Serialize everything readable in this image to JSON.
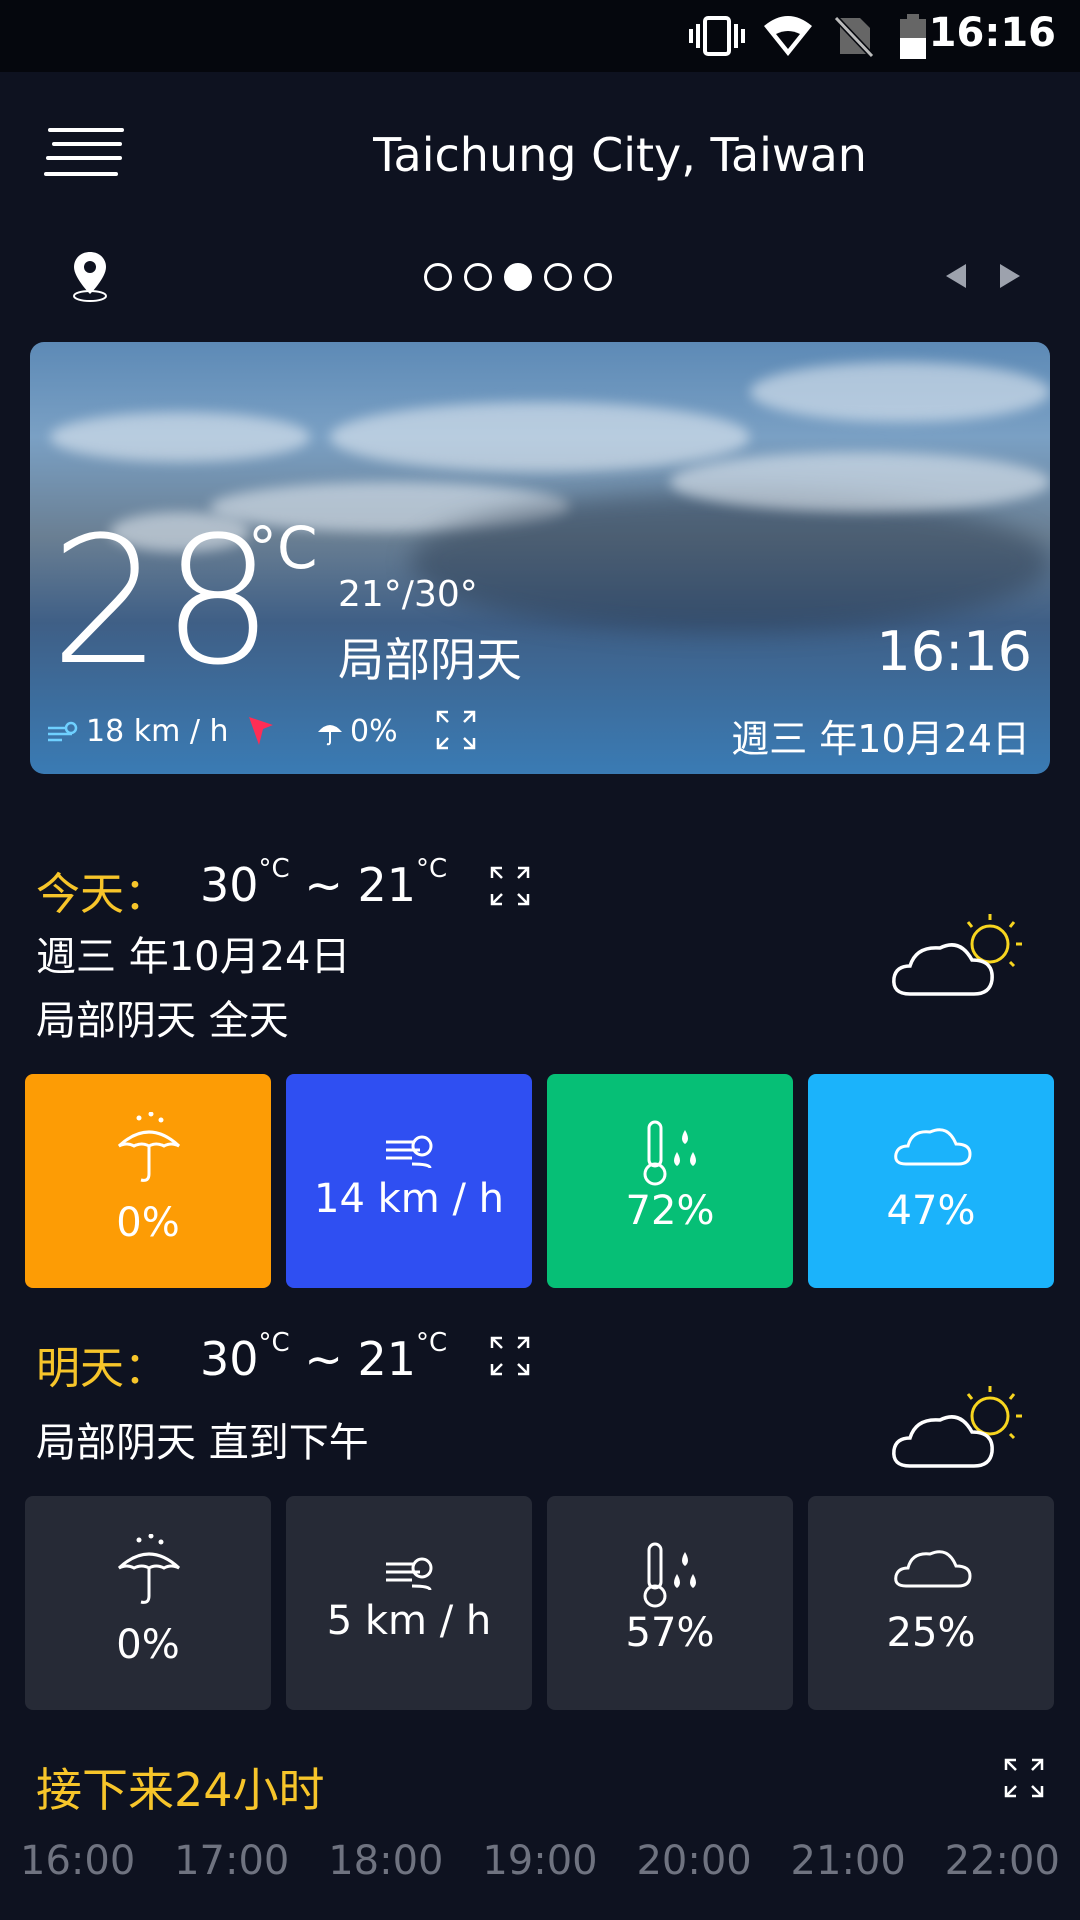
{
  "status_bar": {
    "time": "16:16",
    "icons": [
      "vibrate-icon",
      "wifi-icon",
      "no-sim-icon",
      "battery-icon"
    ]
  },
  "header": {
    "title": "Taichung City, Taiwan"
  },
  "pager": {
    "count": 5,
    "active_index": 2
  },
  "hero": {
    "temp": "28",
    "unit": "°C",
    "range": "21°/30°",
    "condition": "局部阴天",
    "time": "16:16",
    "wind": "18 km / h",
    "rain": "0%",
    "date": "週三 年10月24日"
  },
  "today": {
    "label": "今天：",
    "high": "30",
    "low": "21",
    "unit": "°C",
    "tilde": "~",
    "date": "週三 年10月24日",
    "summary": "局部阴天 全天",
    "cards": [
      {
        "icon": "umbrella-icon",
        "value": "0%",
        "color": "#fd9c05"
      },
      {
        "icon": "wind-icon",
        "value": "14 km / h",
        "color": "#2f4ff2"
      },
      {
        "icon": "humidity-icon",
        "value": "72%",
        "color": "#06bf76"
      },
      {
        "icon": "cloud-icon",
        "value": "47%",
        "color": "#1bb3fb"
      }
    ]
  },
  "tomorrow": {
    "label": "明天：",
    "high": "30",
    "low": "21",
    "unit": "°C",
    "tilde": "~",
    "summary": "局部阴天 直到下午",
    "cards": [
      {
        "icon": "umbrella-icon",
        "value": "0%",
        "color": "#262a36"
      },
      {
        "icon": "wind-icon",
        "value": "5 km / h",
        "color": "#262a36"
      },
      {
        "icon": "humidity-icon",
        "value": "57%",
        "color": "#262a36"
      },
      {
        "icon": "cloud-icon",
        "value": "25%",
        "color": "#262a36"
      }
    ]
  },
  "hourly": {
    "title": "接下来24小时",
    "hours": [
      "16:00",
      "17:00",
      "18:00",
      "19:00",
      "20:00",
      "21:00",
      "22:00"
    ]
  }
}
